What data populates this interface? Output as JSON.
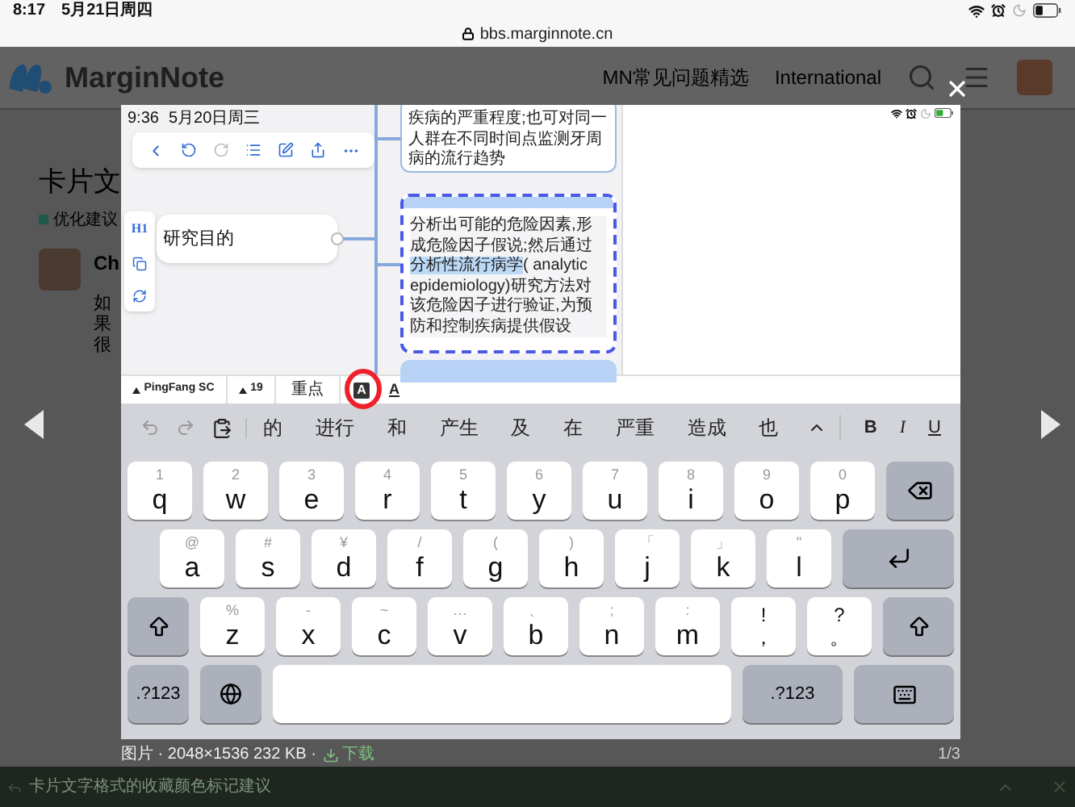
{
  "device_status": {
    "time": "8:17",
    "date": "5月21日周四"
  },
  "address_bar": {
    "url": "bbs.marginnote.cn"
  },
  "site_header": {
    "logo_text": "MarginNote",
    "nav": [
      "MN常见问题精选",
      "International"
    ]
  },
  "topic": {
    "title": "卡片文",
    "category": "优化建议",
    "author": "Ch",
    "post_lines": [
      "如",
      "果",
      "很"
    ]
  },
  "lightbox": {
    "screenshot": {
      "status": {
        "time": "9:36",
        "date": "5月20日周三"
      },
      "side_panel": {
        "heading_label": "H1"
      },
      "mind_map": {
        "root": "研究目的",
        "cards": [
          {
            "selected": false,
            "segments": [
              {
                "text": "疾病的严重程度;也可对同一人群在不同时间点监测牙周病的流行趋势",
                "highlighted": false
              }
            ]
          },
          {
            "selected": true,
            "segments": [
              {
                "text": "分析出可能的危险因素,形成危险因子假说;然后通过",
                "highlighted": false
              },
              {
                "text": "分析性流行病学",
                "highlighted": true
              },
              {
                "text": "( analytic epidemiology)研究方法对该危险因子进行验证,为预防和控制疾病提供假设",
                "highlighted": false
              }
            ]
          }
        ]
      },
      "format_bar": {
        "font": "PingFang SC",
        "size": "19",
        "style": "重点",
        "highlight_button": "A",
        "underline_button": "A"
      },
      "keyboard": {
        "suggestions": [
          "的",
          "进行",
          "和",
          "产生",
          "及",
          "在",
          "严重",
          "造成",
          "也"
        ],
        "format": [
          "B",
          "I",
          "U"
        ],
        "top_row": [
          {
            "main": "q",
            "alt": "1"
          },
          {
            "main": "w",
            "alt": "2"
          },
          {
            "main": "e",
            "alt": "3"
          },
          {
            "main": "r",
            "alt": "4"
          },
          {
            "main": "t",
            "alt": "5"
          },
          {
            "main": "y",
            "alt": "6"
          },
          {
            "main": "u",
            "alt": "7"
          },
          {
            "main": "i",
            "alt": "8"
          },
          {
            "main": "o",
            "alt": "9"
          },
          {
            "main": "p",
            "alt": "0"
          }
        ],
        "middle_row": [
          {
            "main": "a",
            "alt": "@"
          },
          {
            "main": "s",
            "alt": "#"
          },
          {
            "main": "d",
            "alt": "¥"
          },
          {
            "main": "f",
            "alt": "/"
          },
          {
            "main": "g",
            "alt": "("
          },
          {
            "main": "h",
            "alt": ")"
          },
          {
            "main": "j",
            "alt": "「"
          },
          {
            "main": "k",
            "alt": "」"
          },
          {
            "main": "l",
            "alt": "\""
          }
        ],
        "bottom_row": [
          {
            "main": "z",
            "alt": "%",
            "kind": "letter"
          },
          {
            "main": "x",
            "alt": "-",
            "kind": "letter"
          },
          {
            "main": "c",
            "alt": "~",
            "kind": "letter"
          },
          {
            "main": "v",
            "alt": "…",
            "kind": "letter"
          },
          {
            "main": "b",
            "alt": "、",
            "kind": "letter"
          },
          {
            "main": "n",
            "alt": ";",
            "kind": "letter"
          },
          {
            "main": "m",
            "alt": ":",
            "kind": "letter"
          },
          {
            "main": "，",
            "alt": "!",
            "kind": "punct"
          },
          {
            "main": "。",
            "alt": "?",
            "kind": "punct"
          }
        ],
        "mode_keys": [
          ".?123",
          ".?123"
        ]
      }
    },
    "caption": {
      "info": "图片 · 2048×1536 232 KB ·",
      "download": "下载",
      "counter": "1/3"
    }
  },
  "footer_bar": {
    "title": "卡片文字格式的收藏颜色标记建议"
  }
}
